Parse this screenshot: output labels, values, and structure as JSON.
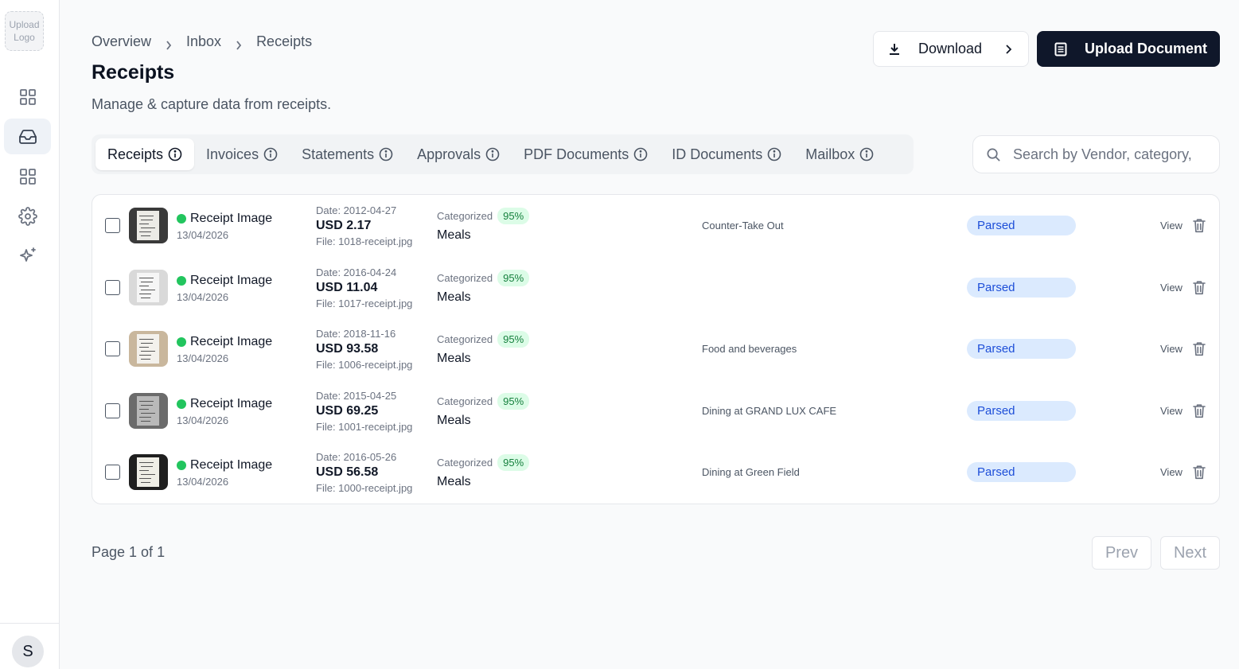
{
  "sidebar": {
    "logo_text": "Upload Logo",
    "nav": [
      {
        "icon": "dashboard-icon"
      },
      {
        "icon": "inbox-icon",
        "active": true
      },
      {
        "icon": "apps-icon"
      },
      {
        "icon": "gear-icon"
      },
      {
        "icon": "sparkles-icon"
      }
    ],
    "avatar_initial": "S"
  },
  "header": {
    "breadcrumb": [
      "Overview",
      "Inbox",
      "Receipts"
    ],
    "title": "Receipts",
    "subtitle": "Manage & capture data from receipts.",
    "download_label": "Download",
    "upload_label": "Upload Document"
  },
  "tabs": [
    {
      "label": "Receipts",
      "active": true
    },
    {
      "label": "Invoices"
    },
    {
      "label": "Statements"
    },
    {
      "label": "Approvals"
    },
    {
      "label": "PDF Documents"
    },
    {
      "label": "ID Documents"
    },
    {
      "label": "Mailbox"
    }
  ],
  "search": {
    "placeholder": "Search by Vendor, category,"
  },
  "rows": [
    {
      "name": "Receipt Image",
      "uploaded": "13/04/2026",
      "date": "Date: 2012-04-27",
      "amount": "USD 2.17",
      "file": "File: 1018-receipt.jpg",
      "cat_label": "Categorized",
      "confidence": "95%",
      "category": "Meals",
      "description": "Counter-Take Out",
      "status": "Parsed",
      "view": "View"
    },
    {
      "name": "Receipt Image",
      "uploaded": "13/04/2026",
      "date": "Date: 2016-04-24",
      "amount": "USD 11.04",
      "file": "File: 1017-receipt.jpg",
      "cat_label": "Categorized",
      "confidence": "95%",
      "category": "Meals",
      "description": "",
      "status": "Parsed",
      "view": "View"
    },
    {
      "name": "Receipt Image",
      "uploaded": "13/04/2026",
      "date": "Date: 2018-11-16",
      "amount": "USD 93.58",
      "file": "File: 1006-receipt.jpg",
      "cat_label": "Categorized",
      "confidence": "95%",
      "category": "Meals",
      "description": "Food and beverages",
      "status": "Parsed",
      "view": "View"
    },
    {
      "name": "Receipt Image",
      "uploaded": "13/04/2026",
      "date": "Date: 2015-04-25",
      "amount": "USD 69.25",
      "file": "File: 1001-receipt.jpg",
      "cat_label": "Categorized",
      "confidence": "95%",
      "category": "Meals",
      "description": "Dining at GRAND LUX CAFE",
      "status": "Parsed",
      "view": "View"
    },
    {
      "name": "Receipt Image",
      "uploaded": "13/04/2026",
      "date": "Date: 2016-05-26",
      "amount": "USD 56.58",
      "file": "File: 1000-receipt.jpg",
      "cat_label": "Categorized",
      "confidence": "95%",
      "category": "Meals",
      "description": "Dining at Green Field",
      "status": "Parsed",
      "view": "View"
    }
  ],
  "pagination": {
    "info": "Page 1 of 1",
    "prev": "Prev",
    "next": "Next"
  },
  "colors": {
    "primary": "#0f172a",
    "status_bg": "#dbeafe",
    "status_text": "#1d4ed8",
    "success": "#22c55e"
  }
}
